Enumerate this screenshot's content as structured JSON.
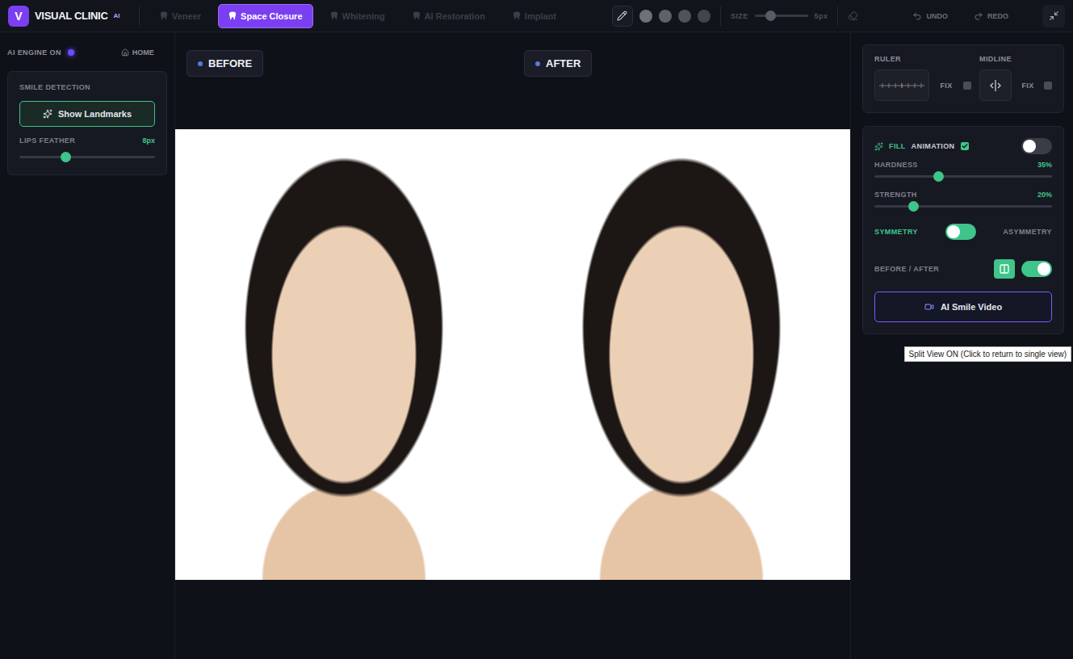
{
  "app": {
    "logo_letter": "V",
    "name": "VISUAL CLINIC",
    "badge": "AI"
  },
  "tabs": [
    {
      "label": "Veneer",
      "selected": false
    },
    {
      "label": "Space Closure",
      "selected": true
    },
    {
      "label": "Whitening",
      "selected": false
    },
    {
      "label": "AI Restoration",
      "selected": false
    },
    {
      "label": "Implant",
      "selected": false
    }
  ],
  "toolbar": {
    "swatches": [
      {
        "color": "#6e717a"
      },
      {
        "color": "#5f626b"
      },
      {
        "color": "#50535c"
      },
      {
        "color": "#42454d"
      }
    ],
    "size_label": "SIZE",
    "size_level": 0.3,
    "size_value": "5px",
    "undo": "UNDO",
    "redo": "REDO"
  },
  "sidebar": {
    "engine": {
      "label": "AI ENGINE ON",
      "on": true
    },
    "home": "HOME",
    "card": {
      "title": "SMILE DETECTION",
      "button": "Show Landmarks",
      "slider": {
        "label": "LIPS FEATHER",
        "value": "8px",
        "level": 0.34
      }
    }
  },
  "views": [
    {
      "label": "BEFORE"
    },
    {
      "label": "AFTER"
    }
  ],
  "controls": {
    "guides": [
      {
        "label": "RULER",
        "fix_label": "FIX",
        "fixed": false
      },
      {
        "label": "MIDLINE",
        "fix_label": "FIX",
        "fixed": false
      }
    ],
    "fill": {
      "label": "FILL",
      "animation_label": "ANIMATION",
      "animation": true,
      "on": false
    },
    "sliders": [
      {
        "label": "HARDNESS",
        "value": "35%",
        "level": 0.36
      },
      {
        "label": "STRENGTH",
        "value": "20%",
        "level": 0.22
      }
    ],
    "symmetry": {
      "left": "SYMMETRY",
      "right": "ASYMMETRY",
      "asymmetry": false
    },
    "before_after": {
      "label": "BEFORE / AFTER",
      "split_view": true,
      "on": true,
      "tooltip": "Split View ON (Click to return to single view)"
    },
    "video_button": "AI Smile Video"
  }
}
